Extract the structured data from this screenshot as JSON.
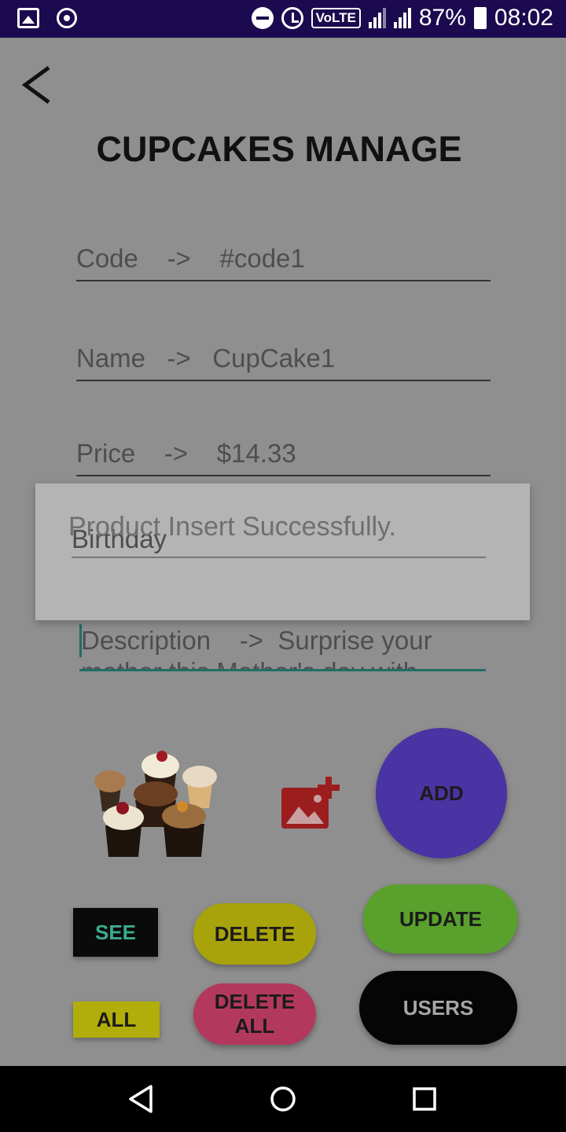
{
  "status_bar": {
    "battery": "87%",
    "time": "08:02",
    "volte": "VoLTE",
    "icons": [
      "image-icon",
      "location-icon",
      "dnd-icon",
      "alarm-icon",
      "volte-icon",
      "signal-icon",
      "signal-icon",
      "battery-charging-icon"
    ]
  },
  "header": {
    "back_icon": "back-arrow-icon",
    "title": "CUPCAKES MANAGE"
  },
  "form": {
    "code": "Code    ->    #code1",
    "name": "Name   ->   CupCake1",
    "price": "Price    ->    $14.33",
    "description_line1": "Description    ->  Surprise your",
    "description_line2": "mother this Mother's day with"
  },
  "dialog": {
    "message": "Product Insert Successfully.",
    "underlying_field": "Birthday"
  },
  "media": {
    "product_image": "cupcakes-photo",
    "add_image_icon": "add-photo-icon"
  },
  "buttons": {
    "add": "ADD",
    "update": "UPDATE",
    "see": "SEE",
    "delete": "DELETE",
    "all": "ALL",
    "delete_all": "DELETE ALL",
    "users": "USERS"
  },
  "nav": {
    "back": "nav-back-icon",
    "home": "nav-home-icon",
    "recents": "nav-recents-icon"
  },
  "colors": {
    "status_bar": "#1b0a4f",
    "overlay_bg": "#8f8f8f",
    "add": "#4a33a3",
    "update": "#5aa02c",
    "delete": "#a8a30a",
    "delete_all": "#b3385e",
    "see_text": "#3bab8d",
    "focus_line": "#1e6f66"
  }
}
